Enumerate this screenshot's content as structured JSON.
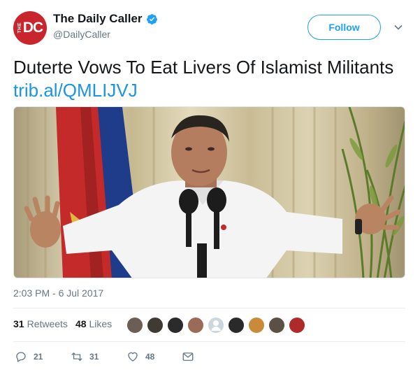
{
  "header": {
    "avatar_initials": "DC",
    "avatar_small": "THE",
    "display_name": "The Daily Caller",
    "handle": "@DailyCaller",
    "verified": true,
    "follow_label": "Follow",
    "brand_color": "#1da1f2",
    "avatar_color": "#c8262c"
  },
  "tweet": {
    "text": "Duterte Vows To Eat Livers Of Islamist Militants ",
    "link": "trib.al/QMLIJVJ",
    "link_color": "#1b95e0",
    "timestamp": "2:03 PM - 6 Jul 2017"
  },
  "stats": {
    "retweets_count": "31",
    "retweets_label": "Retweets",
    "likes_count": "48",
    "likes_label": "Likes"
  },
  "likers": [
    {
      "icon": "profile-avatar",
      "color": "#6b5e54"
    },
    {
      "icon": "profile-avatar",
      "color": "#3f3a33"
    },
    {
      "icon": "profile-avatar",
      "color": "#2b2b2b"
    },
    {
      "icon": "profile-avatar",
      "color": "#9c6b57"
    },
    {
      "icon": "default-egg-avatar",
      "color": "#ccd6dd"
    },
    {
      "icon": "profile-avatar",
      "color": "#2a2a2a"
    },
    {
      "icon": "profile-avatar",
      "color": "#c98b3a"
    },
    {
      "icon": "profile-avatar",
      "color": "#5a5046"
    },
    {
      "icon": "profile-avatar",
      "color": "#b02a2a"
    }
  ],
  "actions": {
    "reply_count": "21",
    "retweet_count": "31",
    "like_count": "48",
    "icons": [
      "reply-icon",
      "retweet-icon",
      "heart-icon",
      "message-icon"
    ]
  }
}
